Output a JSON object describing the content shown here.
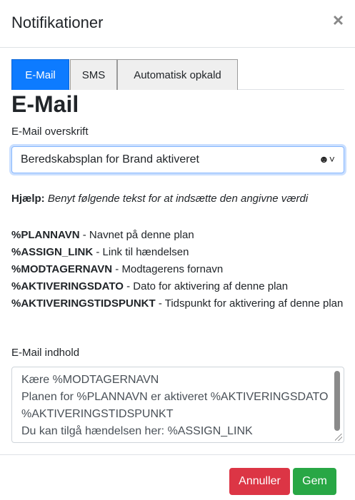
{
  "modal": {
    "title": "Notifikationer",
    "close_symbol": "×"
  },
  "tabs": [
    {
      "label": "E-Mail",
      "active": true
    },
    {
      "label": "SMS",
      "active": false
    },
    {
      "label": "Automatisk opkald",
      "active": false
    }
  ],
  "email": {
    "heading": "E-Mail",
    "subject_label": "E-Mail overskrift",
    "subject_value": "Beredskabsplan for Brand aktiveret",
    "subject_icon": "user-circle-icon",
    "help_label": "Hjælp:",
    "help_text": "Benyt følgende tekst for at indsætte den angivne værdi",
    "placeholders": [
      {
        "key": "%PLANNAVN",
        "desc": " - Navnet på denne plan"
      },
      {
        "key": "%ASSIGN_LINK",
        "desc": " - Link til hændelsen"
      },
      {
        "key": "%MODTAGERNAVN",
        "desc": " - Modtagerens fornavn"
      },
      {
        "key": "%AKTIVERINGSDATO",
        "desc": " - Dato for aktivering af denne plan"
      },
      {
        "key": "%AKTIVERINGSTIDSPUNKT",
        "desc": " - Tidspunkt for aktivering af denne plan"
      }
    ],
    "body_label": "E-Mail indhold",
    "body_lines": [
      "Kære %MODTAGERNAVN",
      "Planen for %PLANNAVN er aktiveret %AKTIVERINGSDATO",
      "%AKTIVERINGSTIDSPUNKT",
      "Du kan tilgå hændelsen her: %ASSIGN_LINK"
    ]
  },
  "footer": {
    "cancel_label": "Annuller",
    "save_label": "Gem"
  },
  "colors": {
    "tab_active": "#0d7bff",
    "cancel": "#dc3545",
    "save": "#28a745"
  }
}
